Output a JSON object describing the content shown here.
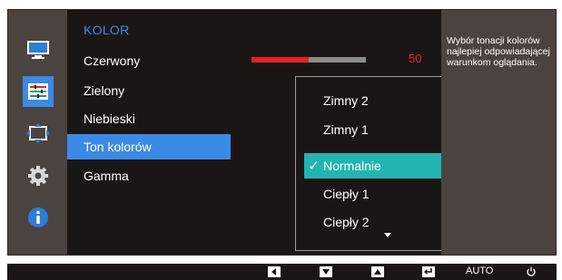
{
  "menu": {
    "title": "KOLOR",
    "items": [
      {
        "label": "Czerwony"
      },
      {
        "label": "Zielony"
      },
      {
        "label": "Niebieski"
      },
      {
        "label": "Ton kolorów"
      },
      {
        "label": "Gamma"
      }
    ],
    "selected_item": "Ton kolorów",
    "red_slider": {
      "value": "50",
      "fill_fraction": 0.5
    }
  },
  "dropdown": {
    "options": [
      {
        "label": "Zimny 2"
      },
      {
        "label": "Zimny 1"
      },
      {
        "label": "Normalnie"
      },
      {
        "label": "Ciepły 1"
      },
      {
        "label": "Ciepły 2"
      }
    ],
    "selected": "Normalnie"
  },
  "help": {
    "text": "Wybór tonacji kolorów najlepiej odpowiadającej warunkom oglądania."
  },
  "sidebar_icons": [
    "monitor-icon",
    "color-adjust-icon",
    "resize-icon",
    "gear-icon",
    "info-icon"
  ],
  "bottom_bar": {
    "auto_label": "AUTO",
    "buttons": [
      "left-arrow-icon",
      "down-arrow-icon",
      "up-arrow-icon",
      "enter-icon",
      "power-icon"
    ]
  },
  "colors": {
    "menu_title": "#3a8fe0",
    "selected_item": "#3b8ae4",
    "selected_option": "#22b5b0",
    "slider_fill": "#e8231f",
    "panel": "#4b4340",
    "menu_bg": "#1a1616"
  }
}
